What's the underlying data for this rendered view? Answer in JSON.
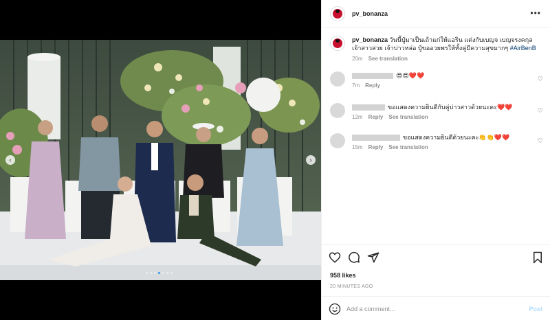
{
  "post": {
    "username": "pv_bonanza",
    "caption_text": "วันนี้ปู๋มาเป็นเถ้าแก่ให้แอริน แต่งกับเบญจ เบญจรงคกุล เจ้าสาวสวย เจ้าบ่าวหล่อ ปู๋ขออวยพรให้ทั้งคู่มีความสุขมากๆ",
    "hashtag": "#AirBenB",
    "caption_time": "20m",
    "see_translation": "See translation",
    "likes": "958 likes",
    "time_ago": "20 MINUTES AGO",
    "add_comment_placeholder": "Add a comment...",
    "post_label": "Post"
  },
  "comments": [
    {
      "text": "😍😍❤️❤️",
      "time": "7m",
      "reply": "Reply",
      "see_translation": ""
    },
    {
      "text": "ขอแสดงความยินดีกับคู่บ่าวสาวด้วยนะคะ❤️❤️",
      "time": "12m",
      "reply": "Reply",
      "see_translation": "See translation"
    },
    {
      "text": "ขอแสดงความยินดีด้วยนะคะ👏👏❤️❤️",
      "time": "15m",
      "reply": "Reply",
      "see_translation": "See translation"
    }
  ],
  "icons": {
    "more": "more-options-icon",
    "like": "heart-icon",
    "comment": "comment-icon",
    "share": "share-icon",
    "save": "bookmark-icon",
    "emoji": "emoji-icon",
    "prev": "chevron-left-icon",
    "next": "chevron-right-icon"
  },
  "colors": {
    "accent": "#3797f0",
    "hashtag": "#00376b",
    "muted": "#8e8e8e",
    "post_disabled": "#b3dbff"
  }
}
